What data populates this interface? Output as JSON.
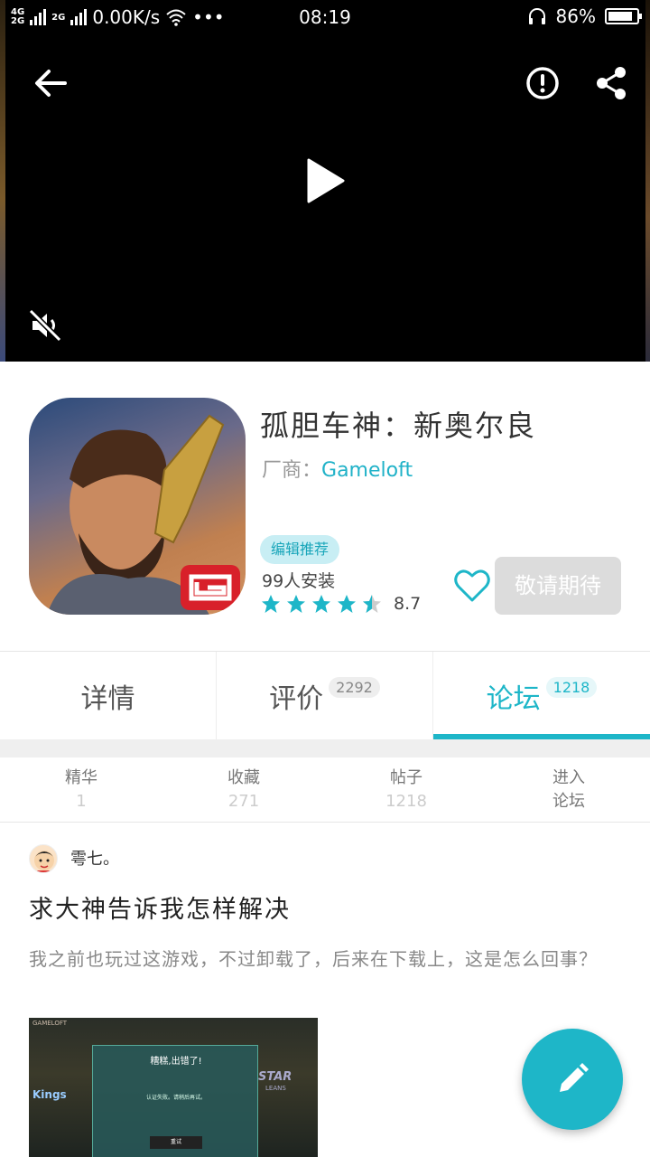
{
  "status_bar": {
    "network_top": "4G",
    "network_bottom": "2G",
    "network2": "2G",
    "speed": "0.00K/s",
    "more": "•••",
    "time": "08:19",
    "battery": "86%",
    "battery_level": 0.86
  },
  "video": {
    "back_icon": "arrow-left-icon",
    "report_icon": "exclamation-circle-icon",
    "share_icon": "share-icon",
    "play_icon": "play-icon",
    "mute_icon": "volume-mute-icon"
  },
  "app": {
    "title": "孤胆车神：新奥尔良",
    "vendor_label": "厂商：",
    "vendor_name": "Gameloft",
    "badge": "编辑推荐",
    "installs": "99人安装",
    "rating": "8.7",
    "rating_stars": 4.5,
    "expect_button": "敬请期待",
    "accent_color": "#1eb6c8"
  },
  "tabs": [
    {
      "label": "详情",
      "count": ""
    },
    {
      "label": "评价",
      "count": "2292"
    },
    {
      "label": "论坛",
      "count": "1218",
      "active": true
    }
  ],
  "forum_stats": [
    {
      "label": "精华",
      "value": "1"
    },
    {
      "label": "收藏",
      "value": "271"
    },
    {
      "label": "帖子",
      "value": "1218"
    },
    {
      "label": "进入",
      "value": "论坛"
    }
  ],
  "post": {
    "author": "雩七。",
    "title": "求大神告诉我怎样解决",
    "body": "我之前也玩过这游戏，不过卸载了，后来在下载上，这是怎么回事？",
    "image": {
      "logo_text": "GAMELOFT",
      "dialog_title": "糟糕,出错了!",
      "dialog_message": "认证失败。请稍后再试。",
      "dialog_button": "重试",
      "left_text": "Kings",
      "right_text": "STAR",
      "right_sub": "LEANS"
    }
  },
  "fab_icon": "pencil-icon"
}
